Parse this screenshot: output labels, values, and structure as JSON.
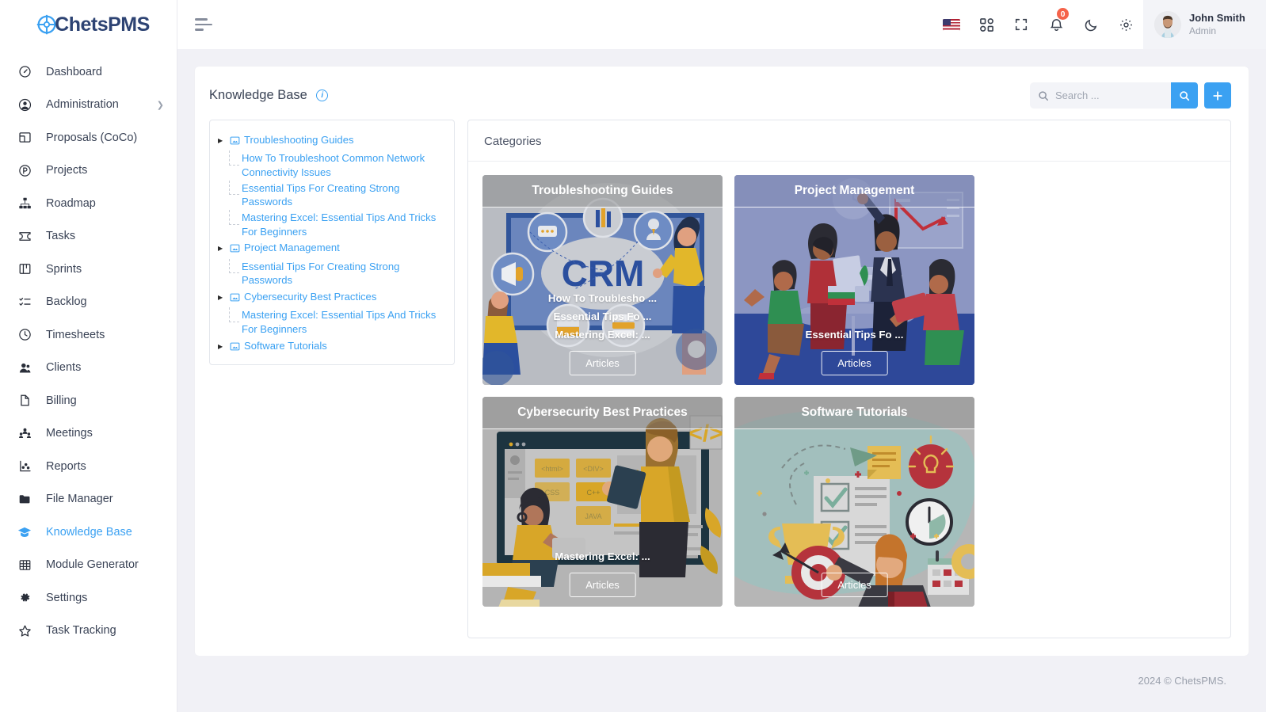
{
  "brand": {
    "name": "ChetsPMS",
    "logo_icon": "chets-logo-icon"
  },
  "sidebar": {
    "items": [
      {
        "label": "Dashboard",
        "icon": "gauge-icon",
        "active": false,
        "chevron": false
      },
      {
        "label": "Administration",
        "icon": "user-circle-icon",
        "active": false,
        "chevron": true
      },
      {
        "label": "Proposals (CoCo)",
        "icon": "layout-icon",
        "active": false,
        "chevron": false
      },
      {
        "label": "Projects",
        "icon": "p-circle-icon",
        "active": false,
        "chevron": false
      },
      {
        "label": "Roadmap",
        "icon": "sitemap-icon",
        "active": false,
        "chevron": false
      },
      {
        "label": "Tasks",
        "icon": "ticket-icon",
        "active": false,
        "chevron": false
      },
      {
        "label": "Sprints",
        "icon": "board-icon",
        "active": false,
        "chevron": false
      },
      {
        "label": "Backlog",
        "icon": "checklist-icon",
        "active": false,
        "chevron": false
      },
      {
        "label": "Timesheets",
        "icon": "clock-icon",
        "active": false,
        "chevron": false
      },
      {
        "label": "Clients",
        "icon": "users-icon",
        "active": false,
        "chevron": false
      },
      {
        "label": "Billing",
        "icon": "file-icon",
        "active": false,
        "chevron": false
      },
      {
        "label": "Meetings",
        "icon": "people-group-icon",
        "active": false,
        "chevron": false
      },
      {
        "label": "Reports",
        "icon": "chart-scatter-icon",
        "active": false,
        "chevron": false
      },
      {
        "label": "File Manager",
        "icon": "folder-icon",
        "active": false,
        "chevron": false
      },
      {
        "label": "Knowledge Base",
        "icon": "graduation-cap-icon",
        "active": true,
        "chevron": false
      },
      {
        "label": "Module Generator",
        "icon": "grid-icon",
        "active": false,
        "chevron": false
      },
      {
        "label": "Settings",
        "icon": "gear-icon",
        "active": false,
        "chevron": false
      },
      {
        "label": "Task Tracking",
        "icon": "star-icon",
        "active": false,
        "chevron": false
      }
    ]
  },
  "topbar": {
    "menu_icon": "hamburger-icon",
    "icons": [
      {
        "name": "language-flag-us-icon"
      },
      {
        "name": "apps-grid-icon"
      },
      {
        "name": "fullscreen-icon"
      },
      {
        "name": "bell-icon",
        "badge": "0"
      },
      {
        "name": "dark-mode-moon-icon"
      },
      {
        "name": "gear-icon"
      }
    ],
    "user": {
      "name": "John Smith",
      "role": "Admin",
      "avatar": "user-avatar"
    }
  },
  "page": {
    "title": "Knowledge Base",
    "info_icon": "info-icon",
    "search": {
      "placeholder": "Search ...",
      "value": ""
    },
    "search_button_icon": "search-icon",
    "add_button_icon": "plus-icon",
    "accent_color": "#3ba1f2"
  },
  "tree": {
    "nodes": [
      {
        "label": "Troubleshooting Guides",
        "icon": "category-icon",
        "children": [
          "How To Troubleshoot Common Network Connectivity Issues",
          "Essential Tips For Creating Strong Passwords",
          "Mastering Excel: Essential Tips And Tricks For Beginners"
        ]
      },
      {
        "label": "Project Management",
        "icon": "category-icon",
        "children": [
          "Essential Tips For Creating Strong Passwords"
        ]
      },
      {
        "label": "Cybersecurity Best Practices",
        "icon": "category-icon",
        "children": [
          "Mastering Excel: Essential Tips And Tricks For Beginners"
        ]
      },
      {
        "label": "Software Tutorials",
        "icon": "category-icon",
        "children": []
      }
    ]
  },
  "categories": {
    "heading": "Categories",
    "cards": [
      {
        "title": "Troubleshooting Guides",
        "links": [
          "How To Troublesho ...",
          "Essential Tips Fo ...",
          "Mastering Excel: ..."
        ],
        "button": "Articles",
        "theme": "crm-illustration"
      },
      {
        "title": "Project Management",
        "links": [
          "Essential Tips Fo ..."
        ],
        "button": "Articles",
        "theme": "meeting-illustration"
      },
      {
        "title": "Cybersecurity Best Practices",
        "links": [
          "Mastering Excel: ..."
        ],
        "button": "Articles",
        "theme": "coding-illustration"
      },
      {
        "title": "Software Tutorials",
        "links": [],
        "button": "Articles",
        "theme": "tutorial-illustration"
      }
    ]
  },
  "footer": {
    "text": "2024 © ChetsPMS."
  }
}
